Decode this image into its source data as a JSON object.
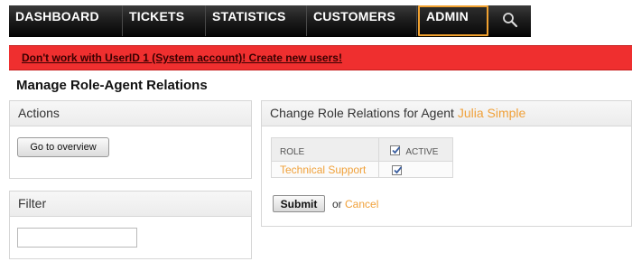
{
  "nav": {
    "items": [
      {
        "label": "DASHBOARD"
      },
      {
        "label": "TICKETS"
      },
      {
        "label": "STATISTICS"
      },
      {
        "label": "CUSTOMERS"
      },
      {
        "label": "ADMIN"
      }
    ],
    "active": "ADMIN",
    "search_icon": "search-icon",
    "accent_color": "#f1a12f"
  },
  "notice": {
    "text": "Don't work with UserID 1 (System account)! Create new users!",
    "color": "#ef2f2f"
  },
  "page": {
    "title": "Manage Role-Agent Relations"
  },
  "actions": {
    "title": "Actions",
    "go_to_overview": "Go to overview"
  },
  "filter": {
    "title": "Filter",
    "value": "",
    "placeholder": ""
  },
  "relations": {
    "title_prefix": "Change Role Relations for Agent",
    "agent_name": "Julia Simple",
    "columns": {
      "role": "ROLE",
      "active": "ACTIVE"
    },
    "active_all_checked": true,
    "rows": [
      {
        "role": "Technical Support",
        "active": true
      }
    ],
    "submit": "Submit",
    "or": "or",
    "cancel": "Cancel"
  }
}
